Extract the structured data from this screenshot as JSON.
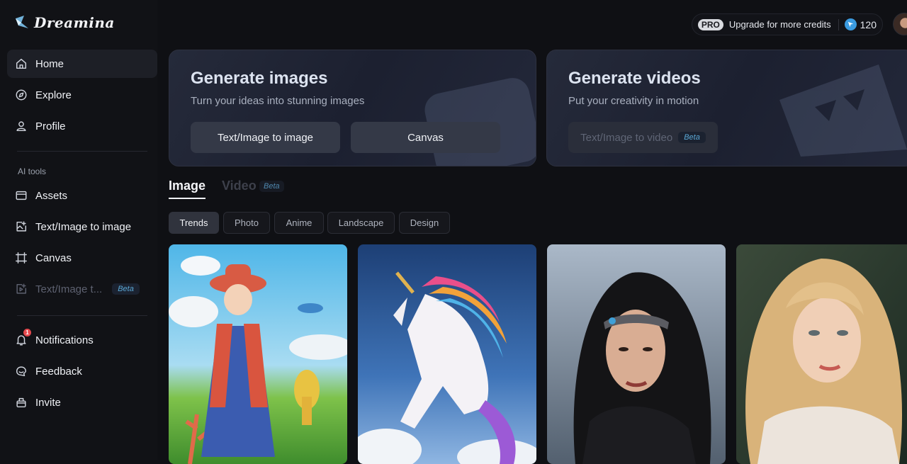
{
  "app": {
    "name": "Dreamina"
  },
  "sidebar": {
    "items": [
      {
        "label": "Home",
        "icon": "home-icon"
      },
      {
        "label": "Explore",
        "icon": "compass-icon"
      },
      {
        "label": "Profile",
        "icon": "user-icon"
      }
    ],
    "section_title": "AI tools",
    "tools": [
      {
        "label": "Assets",
        "icon": "folder-icon"
      },
      {
        "label": "Text/Image to image",
        "icon": "image-plus-icon"
      },
      {
        "label": "Canvas",
        "icon": "canvas-frame-icon"
      },
      {
        "label": "Text/Image t...",
        "icon": "video-plus-icon",
        "badge": "Beta"
      }
    ],
    "bottom": [
      {
        "label": "Notifications",
        "icon": "bell-icon",
        "count": "1"
      },
      {
        "label": "Feedback",
        "icon": "chat-icon"
      },
      {
        "label": "Invite",
        "icon": "gift-icon"
      }
    ]
  },
  "header": {
    "pro_badge": "PRO",
    "upgrade_text": "Upgrade for more credits",
    "credits": "120"
  },
  "hero": {
    "images": {
      "title": "Generate images",
      "subtitle": "Turn your ideas into stunning images",
      "buttons": [
        "Text/Image to image",
        "Canvas"
      ]
    },
    "videos": {
      "title": "Generate videos",
      "subtitle": "Put your creativity in motion",
      "button": "Text/Image to video",
      "badge": "Beta"
    }
  },
  "tabs": [
    {
      "label": "Image",
      "active": true
    },
    {
      "label": "Video",
      "active": false,
      "badge": "Beta"
    }
  ],
  "filters": [
    {
      "label": "Trends",
      "active": true
    },
    {
      "label": "Photo",
      "active": false
    },
    {
      "label": "Anime",
      "active": false
    },
    {
      "label": "Landscape",
      "active": false
    },
    {
      "label": "Design",
      "active": false
    }
  ],
  "colors": {
    "background": "#0f1014",
    "accent": "#3b9be0",
    "beta": "#5aa7d4",
    "notification": "#e5484d"
  }
}
